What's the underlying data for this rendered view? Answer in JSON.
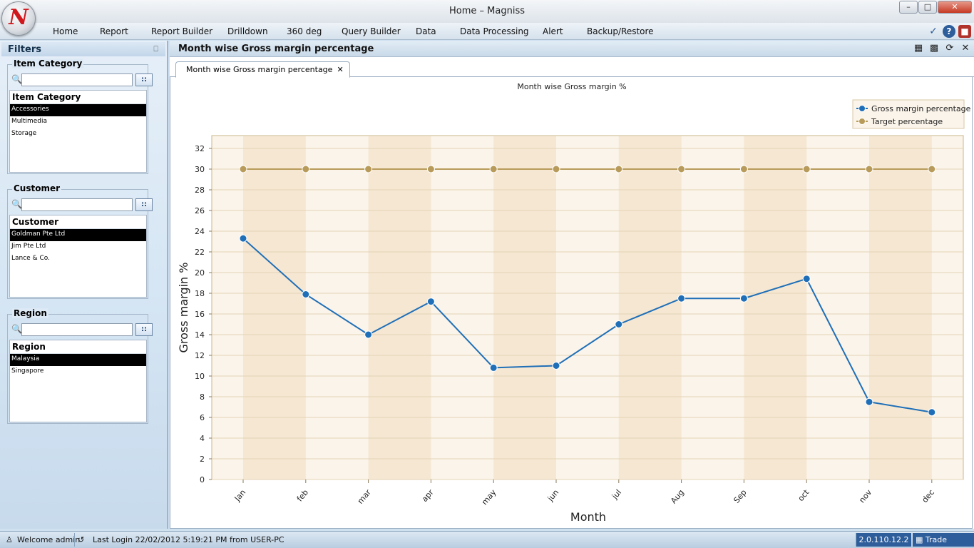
{
  "window": {
    "title": "Home – Magniss",
    "logo_letter": "N",
    "min": "–",
    "max": "□",
    "close": "✕"
  },
  "menu": {
    "items": [
      "Home",
      "Report",
      "Report Builder",
      "Drilldown",
      "360 deg",
      "Query Builder",
      "Data",
      "Data Processing",
      "Alert",
      "Backup/Restore"
    ],
    "tools": [
      "chevron-down-icon",
      "help-icon",
      "exit-icon"
    ]
  },
  "filters": {
    "title": "Filters",
    "pin": "⎕",
    "search_button": "::",
    "groups": [
      {
        "title": "Item Category",
        "header": "Item Category",
        "search_value": "",
        "items": [
          "Accessories",
          "Multimedia",
          "Storage"
        ],
        "selected": 0
      },
      {
        "title": "Customer",
        "header": "Customer",
        "search_value": "",
        "items": [
          "Goldman Pte Ltd",
          "Jim Pte Ltd",
          "Lance & Co."
        ],
        "selected": 0
      },
      {
        "title": "Region",
        "header": "Region",
        "search_value": "",
        "items": [
          "Malaysia",
          "Singapore"
        ],
        "selected": 0
      }
    ]
  },
  "report": {
    "title": "Month wise Gross margin percentage",
    "tab_label": "Month wise Gross margin percentage",
    "tab_close": "✕",
    "tools": [
      "grid-icon",
      "export-icon",
      "refresh-icon",
      "close-icon"
    ]
  },
  "chart_data": {
    "type": "line",
    "title": "Month wise Gross margin %",
    "xlabel": "Month",
    "ylabel": "Gross margin %",
    "categories": [
      "Jan",
      "feb",
      "mar",
      "apr",
      "may",
      "jun",
      "jul",
      "Aug",
      "Sep",
      "oct",
      "nov",
      "dec"
    ],
    "ylim": [
      0,
      32
    ],
    "yticks": [
      0,
      2,
      4,
      6,
      8,
      10,
      12,
      14,
      16,
      18,
      20,
      22,
      24,
      26,
      28,
      30,
      32
    ],
    "grid": true,
    "legend_position": "top-right",
    "series": [
      {
        "name": "Gross margin percentage",
        "color": "#1f6fb8",
        "values": [
          23.3,
          17.9,
          14.0,
          17.2,
          10.8,
          11.0,
          15.0,
          17.5,
          17.5,
          19.4,
          7.5,
          6.5
        ]
      },
      {
        "name": "Target percentage",
        "color": "#b89b5a",
        "values": [
          30,
          30,
          30,
          30,
          30,
          30,
          30,
          30,
          30,
          30,
          30,
          30
        ]
      }
    ]
  },
  "status": {
    "welcome": "Welcome admin",
    "last_login": "Last Login 22/02/2012 5:19:21 PM  from USER-PC",
    "version": "2.0.110.12.2",
    "module": "Trade"
  }
}
